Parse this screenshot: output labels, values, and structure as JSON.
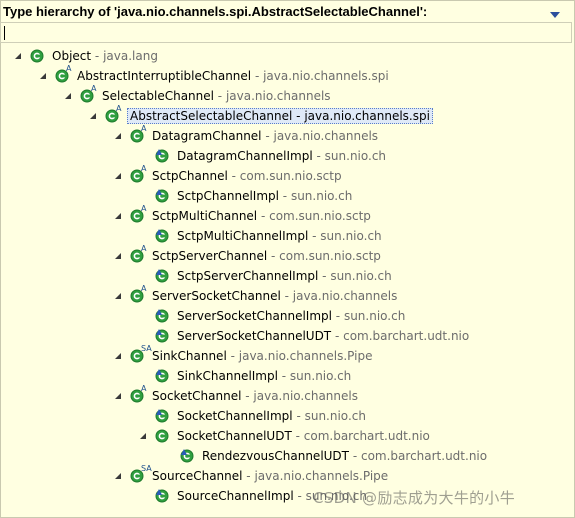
{
  "header": {
    "title": "Type hierarchy of 'java.nio.channels.spi.AbstractSelectableChannel':",
    "filter_value": ""
  },
  "tree": [
    {
      "name": "Object",
      "pkg": "java.lang",
      "abstract": false,
      "expanded": true
    },
    {
      "name": "AbstractInterruptibleChannel",
      "pkg": "java.nio.channels.spi",
      "abstract": true,
      "expanded": true
    },
    {
      "name": "SelectableChannel",
      "pkg": "java.nio.channels",
      "abstract": true,
      "expanded": true
    },
    {
      "name": "AbstractSelectableChannel",
      "pkg": "java.nio.channels.spi",
      "abstract": true,
      "expanded": true,
      "selected": true
    },
    {
      "name": "DatagramChannel",
      "pkg": "java.nio.channels",
      "abstract": true,
      "expanded": true
    },
    {
      "name": "DatagramChannelImpl",
      "pkg": "sun.nio.ch",
      "abstract": false
    },
    {
      "name": "SctpChannel",
      "pkg": "com.sun.nio.sctp",
      "abstract": true,
      "expanded": true
    },
    {
      "name": "SctpChannelImpl",
      "pkg": "sun.nio.ch",
      "abstract": false
    },
    {
      "name": "SctpMultiChannel",
      "pkg": "com.sun.nio.sctp",
      "abstract": true,
      "expanded": true
    },
    {
      "name": "SctpMultiChannelImpl",
      "pkg": "sun.nio.ch",
      "abstract": false
    },
    {
      "name": "SctpServerChannel",
      "pkg": "com.sun.nio.sctp",
      "abstract": true,
      "expanded": true
    },
    {
      "name": "SctpServerChannelImpl",
      "pkg": "sun.nio.ch",
      "abstract": false
    },
    {
      "name": "ServerSocketChannel",
      "pkg": "java.nio.channels",
      "abstract": true,
      "expanded": true
    },
    {
      "name": "ServerSocketChannelImpl",
      "pkg": "sun.nio.ch",
      "abstract": false
    },
    {
      "name": "ServerSocketChannelUDT",
      "pkg": "com.barchart.udt.nio",
      "abstract": false
    },
    {
      "name": "SinkChannel",
      "pkg": "java.nio.channels.Pipe",
      "abstract": true,
      "static": true,
      "expanded": true
    },
    {
      "name": "SinkChannelImpl",
      "pkg": "sun.nio.ch",
      "abstract": false
    },
    {
      "name": "SocketChannel",
      "pkg": "java.nio.channels",
      "abstract": true,
      "expanded": true
    },
    {
      "name": "SocketChannelImpl",
      "pkg": "sun.nio.ch",
      "abstract": false
    },
    {
      "name": "SocketChannelUDT",
      "pkg": "com.barchart.udt.nio",
      "abstract": false,
      "expanded": true
    },
    {
      "name": "RendezvousChannelUDT",
      "pkg": "com.barchart.udt.nio",
      "abstract": false
    },
    {
      "name": "SourceChannel",
      "pkg": "java.nio.channels.Pipe",
      "abstract": true,
      "static": true,
      "expanded": true
    },
    {
      "name": "SourceChannelImpl",
      "pkg": "sun.nio.ch",
      "abstract": false
    }
  ],
  "separator": " - ",
  "watermark": "CSDN @励志成为大牛的小牛",
  "icons": {
    "class": "class-icon",
    "abstract_marker": "A",
    "static_abstract_marker": "SA",
    "expand": "expanded-twisty-icon",
    "collapse": "collapsed-twisty-icon",
    "menu": "view-menu-icon"
  },
  "colors": {
    "background": "#ffffe1",
    "class_icon": "#2f9f3f",
    "package_text": "#6c6c6c",
    "selection": "#dfe9f7"
  }
}
